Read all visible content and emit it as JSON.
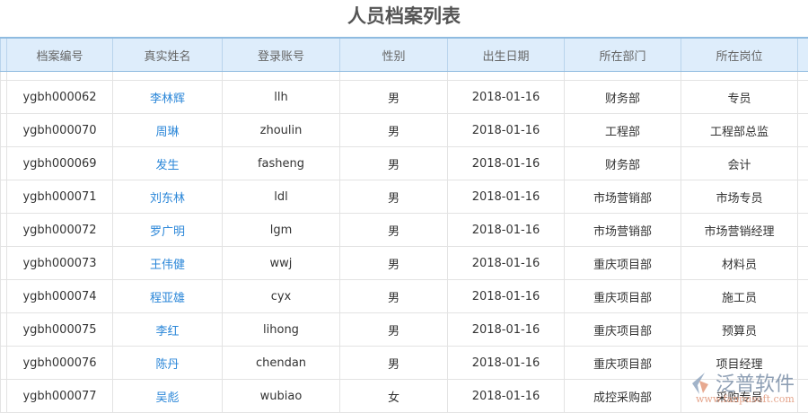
{
  "title": "人员档案列表",
  "columns": [
    "档案编号",
    "真实姓名",
    "登录账号",
    "性别",
    "出生日期",
    "所在部门",
    "所在岗位"
  ],
  "rows": [
    [
      "ygbh000062",
      "李林辉",
      "llh",
      "男",
      "2018-01-16",
      "财务部",
      "专员"
    ],
    [
      "ygbh000070",
      "周琳",
      "zhoulin",
      "男",
      "2018-01-16",
      "工程部",
      "工程部总监"
    ],
    [
      "ygbh000069",
      "发生",
      "fasheng",
      "男",
      "2018-01-16",
      "财务部",
      "会计"
    ],
    [
      "ygbh000071",
      "刘东林",
      "ldl",
      "男",
      "2018-01-16",
      "市场营销部",
      "市场专员"
    ],
    [
      "ygbh000072",
      "罗广明",
      "lgm",
      "男",
      "2018-01-16",
      "市场营销部",
      "市场营销经理"
    ],
    [
      "ygbh000073",
      "王伟健",
      "wwj",
      "男",
      "2018-01-16",
      "重庆项目部",
      "材料员"
    ],
    [
      "ygbh000074",
      "程亚雄",
      "cyx",
      "男",
      "2018-01-16",
      "重庆项目部",
      "施工员"
    ],
    [
      "ygbh000075",
      "李红",
      "lihong",
      "男",
      "2018-01-16",
      "重庆项目部",
      "预算员"
    ],
    [
      "ygbh000076",
      "陈丹",
      "chendan",
      "男",
      "2018-01-16",
      "重庆项目部",
      "项目经理"
    ],
    [
      "ygbh000077",
      "吴彪",
      "wubiao",
      "女",
      "2018-01-16",
      "成控采购部",
      "采购专员"
    ]
  ],
  "watermark": {
    "cn": "泛普软件",
    "en": "www.fanpusoft.com"
  }
}
